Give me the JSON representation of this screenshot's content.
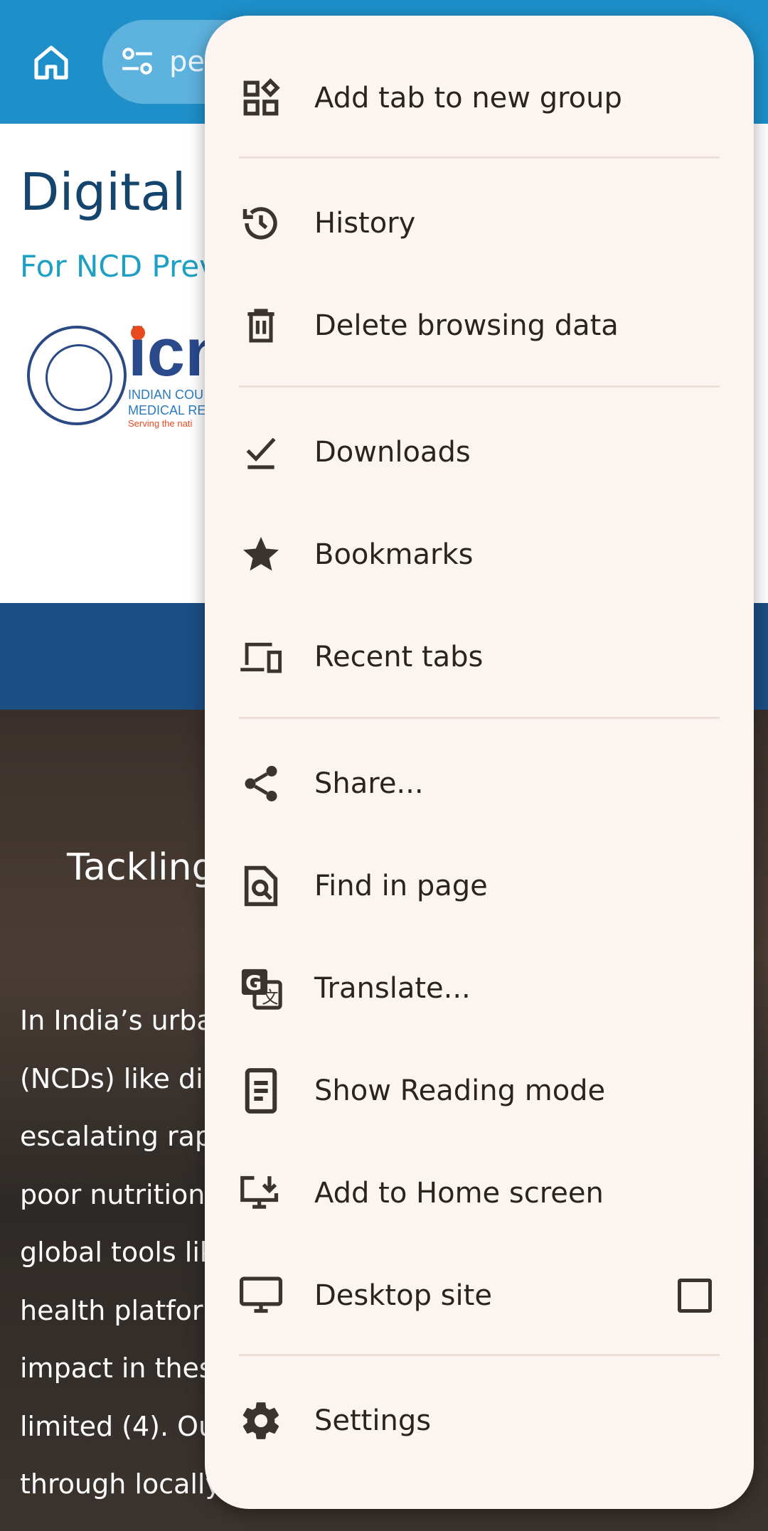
{
  "toolbar": {
    "url_fragment": "pe"
  },
  "page": {
    "title": "Digital H",
    "subtitle": "For NCD Prev",
    "logo_text": "icn",
    "logo_line1": "INDIAN COU",
    "logo_line2": "MEDICAL RE",
    "logo_tagline": "Serving the nati",
    "hero_heading": "Tackling",
    "hero_lines": [
      "In India’s urba",
      "(NCDs) like dia",
      "escalating rap",
      "poor nutrition",
      "global tools lik",
      "health platfor",
      "impact in thes",
      "limited (4).  Ou",
      "through locally"
    ]
  },
  "menu": {
    "items": [
      {
        "label": "Add tab to new group",
        "icon": "tab-group-icon"
      },
      {
        "label": "History",
        "icon": "history-icon"
      },
      {
        "label": "Delete browsing data",
        "icon": "trash-icon"
      },
      {
        "label": "Downloads",
        "icon": "download-check-icon"
      },
      {
        "label": "Bookmarks",
        "icon": "star-icon"
      },
      {
        "label": "Recent tabs",
        "icon": "devices-icon"
      },
      {
        "label": "Share...",
        "icon": "share-icon"
      },
      {
        "label": "Find in page",
        "icon": "find-in-page-icon"
      },
      {
        "label": "Translate...",
        "icon": "translate-icon"
      },
      {
        "label": "Show Reading mode",
        "icon": "reading-mode-icon"
      },
      {
        "label": "Add to Home screen",
        "icon": "add-to-home-icon"
      },
      {
        "label": "Desktop site",
        "icon": "desktop-icon",
        "checked": false
      },
      {
        "label": "Settings",
        "icon": "gear-icon"
      }
    ]
  },
  "colors": {
    "toolbar": "#1e8fc9",
    "menu_bg": "#fcf4f1",
    "menu_text": "#2a2420",
    "title": "#15446d",
    "subtitle": "#1ea0c4"
  }
}
